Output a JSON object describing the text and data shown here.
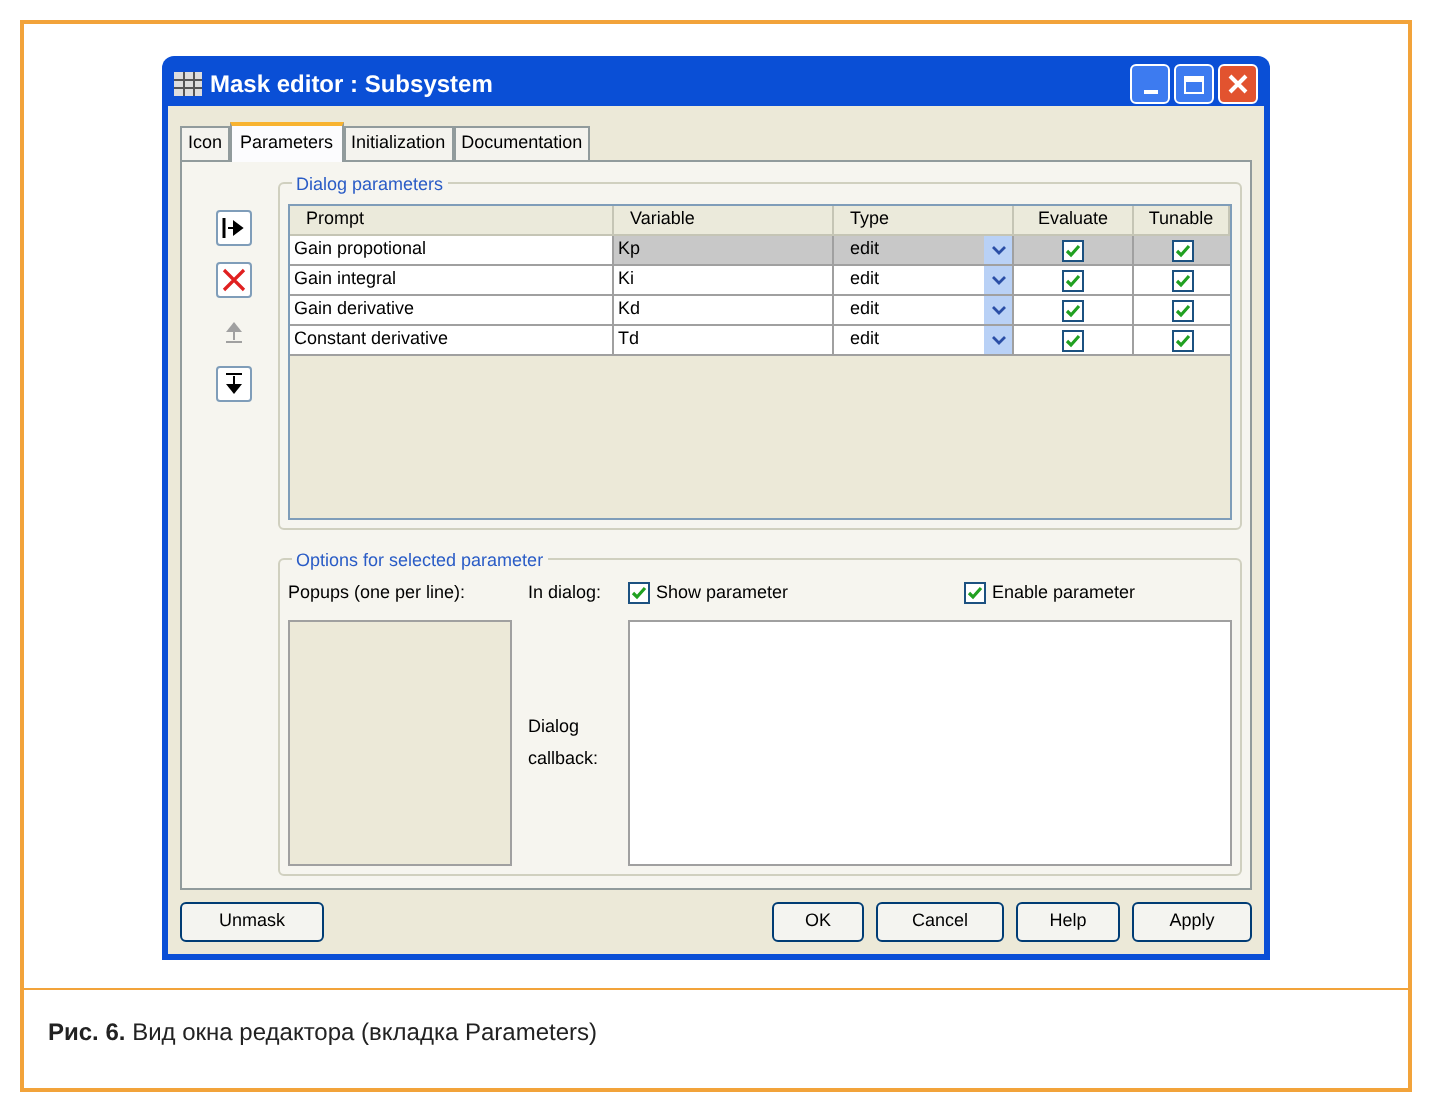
{
  "window": {
    "title": "Mask editor : Subsystem",
    "controls": [
      {
        "kind": "minimize"
      },
      {
        "kind": "maximize"
      },
      {
        "kind": "close"
      }
    ]
  },
  "tabs": [
    {
      "label": "Icon",
      "selected": false
    },
    {
      "label": "Parameters",
      "selected": true
    },
    {
      "label": "Initialization",
      "selected": false
    },
    {
      "label": "Documentation",
      "selected": false
    }
  ],
  "dialog_parameters": {
    "title": "Dialog parameters",
    "tools": [
      {
        "kind": "add",
        "disabled": false
      },
      {
        "kind": "delete",
        "disabled": false
      },
      {
        "kind": "up",
        "disabled": true
      },
      {
        "kind": "down",
        "disabled": false
      }
    ],
    "columns": [
      "Prompt",
      "Variable",
      "Type",
      "Evaluate",
      "Tunable"
    ],
    "rows": [
      {
        "prompt": "Gain propotional",
        "variable": "Kp",
        "type": "edit",
        "evaluate": true,
        "tunable": true,
        "selected": true
      },
      {
        "prompt": "Gain integral",
        "variable": "Ki",
        "type": "edit",
        "evaluate": true,
        "tunable": true,
        "selected": false
      },
      {
        "prompt": "Gain derivative",
        "variable": "Kd",
        "type": "edit",
        "evaluate": true,
        "tunable": true,
        "selected": false
      },
      {
        "prompt": "Constant derivative",
        "variable": "Td",
        "type": "edit",
        "evaluate": true,
        "tunable": true,
        "selected": false
      }
    ]
  },
  "options": {
    "title": "Options for selected parameter",
    "popups_label": "Popups (one per line):",
    "in_dialog_label": "In dialog:",
    "show_parameter": {
      "label": "Show parameter",
      "checked": true
    },
    "enable_parameter": {
      "label": "Enable parameter",
      "checked": true
    },
    "callback_label": "Dialog callback:"
  },
  "buttons": [
    {
      "label": "Unmask"
    },
    {
      "label": "OK"
    },
    {
      "label": "Cancel"
    },
    {
      "label": "Help"
    },
    {
      "label": "Apply"
    }
  ],
  "caption": {
    "number": "Рис. 6.",
    "text": "Вид окна редактора (вкладка Parameters)"
  }
}
